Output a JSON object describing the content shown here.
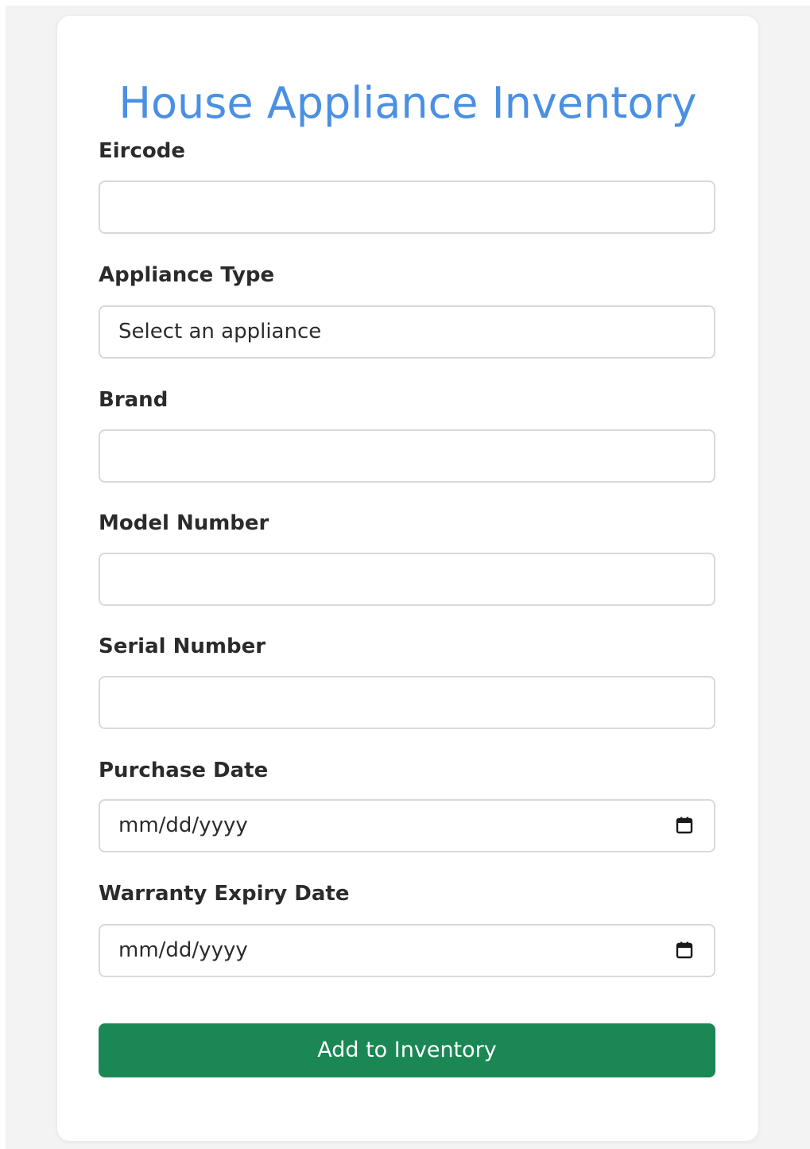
{
  "form": {
    "title": "House Appliance Inventory",
    "fields": [
      {
        "label": "Eircode",
        "value": ""
      },
      {
        "label": "Appliance Type",
        "value": "Select an appliance"
      },
      {
        "label": "Brand",
        "value": ""
      },
      {
        "label": "Model Number",
        "value": ""
      },
      {
        "label": "Serial Number",
        "value": ""
      },
      {
        "label": "Purchase Date",
        "value": "mm/dd/yyyy",
        "icon": "calendar-icon"
      },
      {
        "label": "Warranty Expiry Date",
        "value": "mm/dd/yyyy",
        "icon": "calendar-icon"
      }
    ],
    "submit_label": "Add to Inventory"
  },
  "colors": {
    "title": "#4a90e2",
    "button": "#1a8754",
    "background": "#f3f3f3"
  }
}
